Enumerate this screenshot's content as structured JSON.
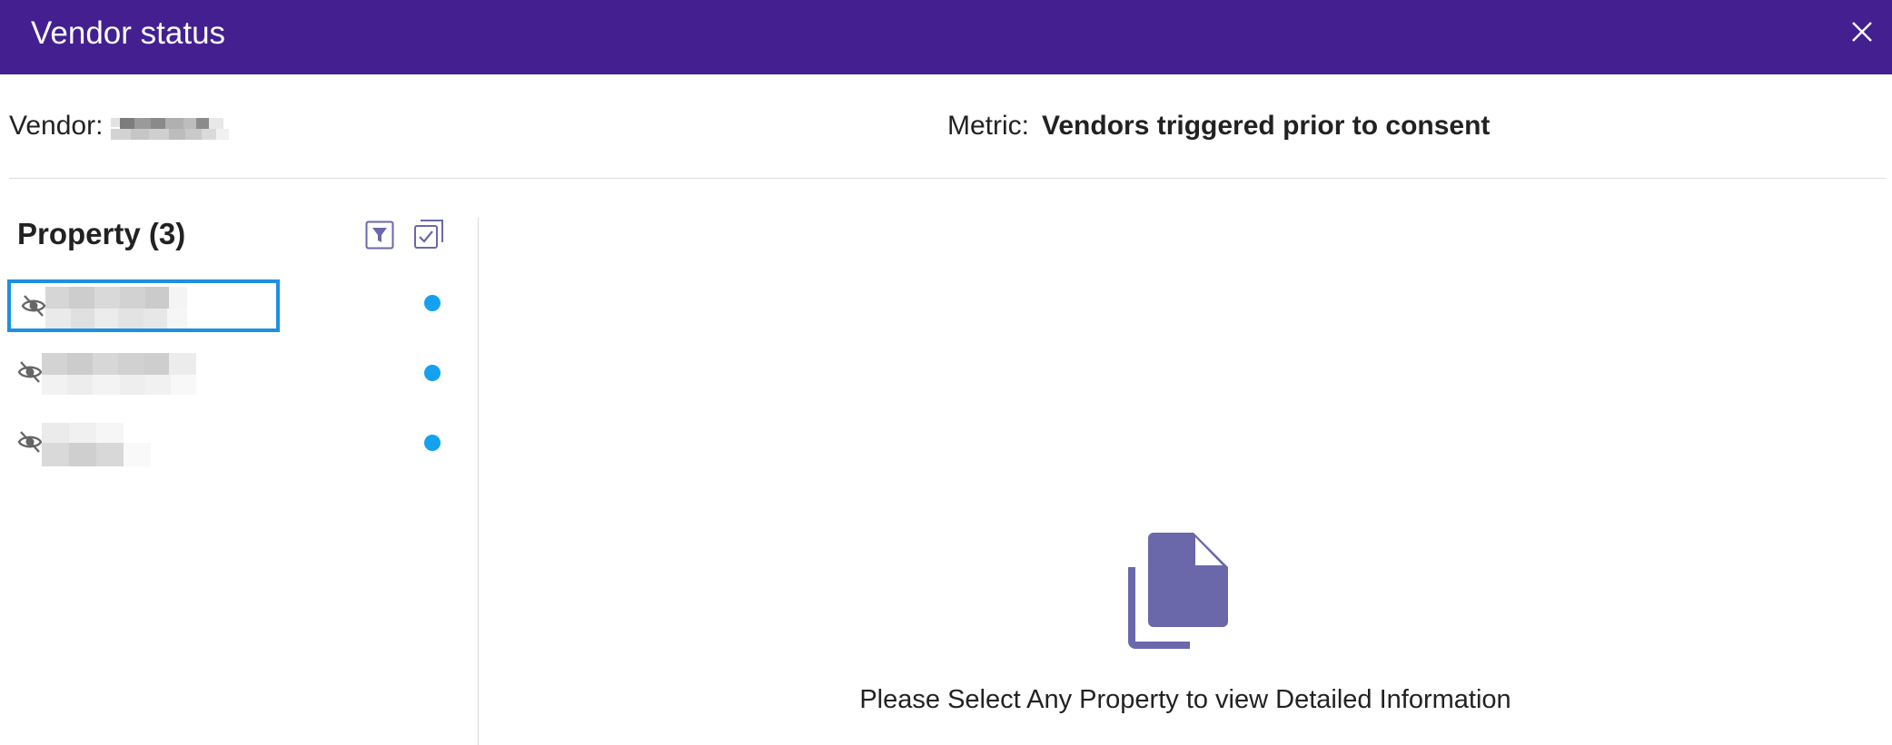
{
  "dialog": {
    "title": "Vendor status",
    "close_icon": "close-icon"
  },
  "info": {
    "vendor_label": "Vendor:",
    "metric_label": "Metric:",
    "metric_value": "Vendors triggered prior to consent"
  },
  "property_panel": {
    "title": "Property (3)",
    "filter_icon": "filter-icon",
    "select_all_icon": "select-all-icon",
    "items": [
      {
        "visibility_icon": "eye-off-icon",
        "status_color": "#14a2f0",
        "selected": true
      },
      {
        "visibility_icon": "eye-off-icon",
        "status_color": "#14a2f0",
        "selected": false
      },
      {
        "visibility_icon": "eye-off-icon",
        "status_color": "#14a2f0",
        "selected": false
      }
    ]
  },
  "empty_state": {
    "icon": "documents-icon",
    "message": "Please Select Any Property to view Detailed Information"
  },
  "colors": {
    "header": "#431f90",
    "accent": "#6a67ab",
    "selection": "#1e90e3",
    "status_dot": "#14a2f0"
  }
}
